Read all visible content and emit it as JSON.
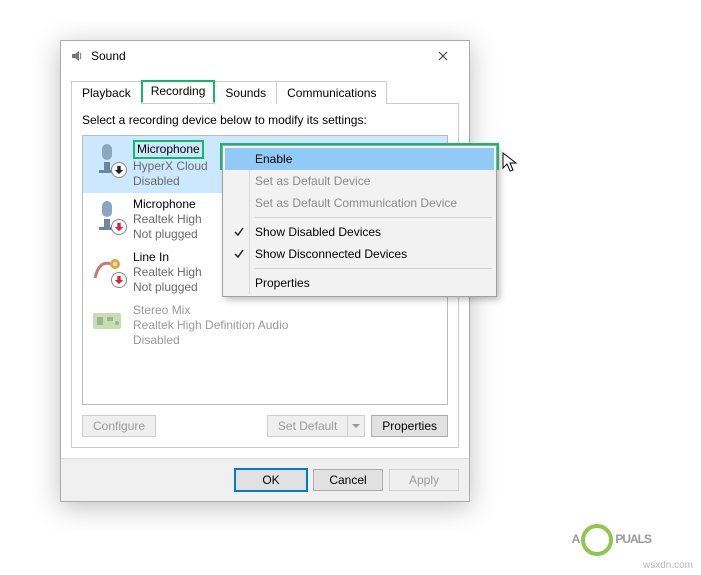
{
  "window": {
    "title": "Sound"
  },
  "tabs": {
    "playback": "Playback",
    "recording": "Recording",
    "sounds": "Sounds",
    "communications": "Communications"
  },
  "instruction": "Select a recording device below to modify its settings:",
  "devices": [
    {
      "name": "Microphone",
      "sub": "HyperX Cloud",
      "status": "Disabled"
    },
    {
      "name": "Microphone",
      "sub": "Realtek High",
      "status": "Not plugged"
    },
    {
      "name": "Line In",
      "sub": "Realtek High",
      "status": "Not plugged"
    },
    {
      "name": "Stereo Mix",
      "sub": "Realtek High Definition Audio",
      "status": "Disabled"
    }
  ],
  "buttons": {
    "configure": "Configure",
    "set_default": "Set Default",
    "properties": "Properties",
    "ok": "OK",
    "cancel": "Cancel",
    "apply": "Apply"
  },
  "context_menu": {
    "enable": "Enable",
    "set_default": "Set as Default Device",
    "set_comm": "Set as Default Communication Device",
    "show_disabled": "Show Disabled Devices",
    "show_disconnected": "Show Disconnected Devices",
    "properties": "Properties"
  },
  "watermark": "wsxdn.com",
  "logo": {
    "pre": "A",
    "post": "PUALS"
  }
}
